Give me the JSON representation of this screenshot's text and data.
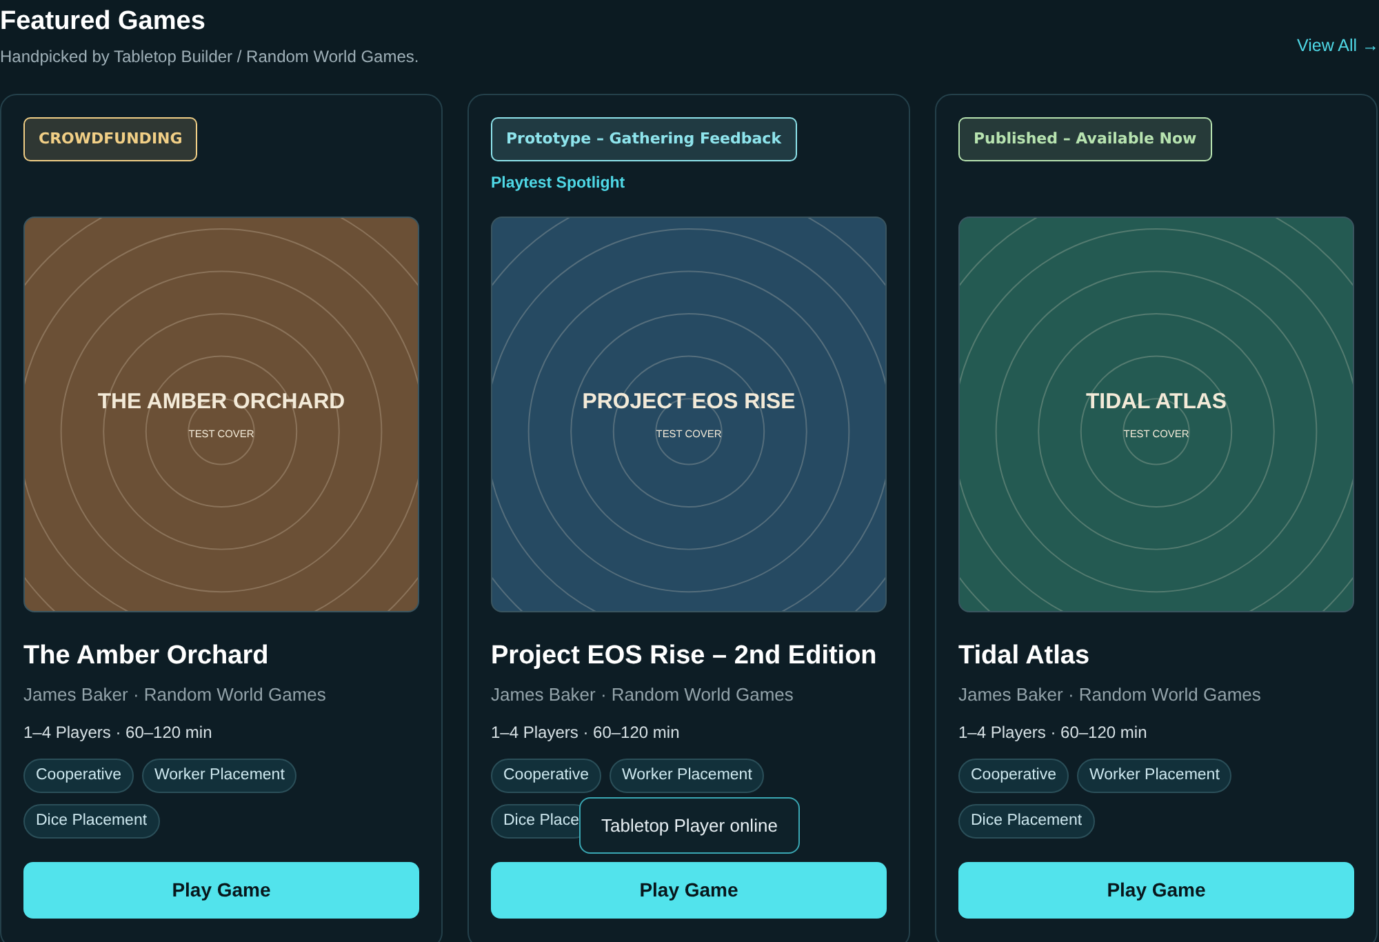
{
  "header": {
    "title": "Featured Games",
    "subtitle": "Handpicked by Tabletop Builder / Random World Games.",
    "link": "View All →"
  },
  "games": [
    {
      "status": {
        "text": "CROWDFUNDING",
        "color": "#f1cf86"
      },
      "cover": {
        "title": "THE AMBER ORCHARD",
        "caption": "TEST COVER",
        "color": "#6b5036"
      },
      "title": "The Amber Orchard",
      "byline": "James Baker · Random World Games",
      "meta": "1–4 Players · 60–120 min",
      "tags": [
        "Cooperative",
        "Worker Placement",
        "Dice Placement"
      ],
      "button": "Play Game"
    },
    {
      "status": {
        "text": "Prototype – Gathering Feedback",
        "color": "#8ee4ec"
      },
      "spotlight": "Playtest Spotlight",
      "cover": {
        "title": "PROJECT EOS RISE",
        "caption": "TEST COVER",
        "color": "#264a62"
      },
      "title": "Project EOS Rise – 2nd Edition",
      "byline": "James Baker · Random World Games",
      "meta": "1–4 Players · 60–120 min",
      "tags": [
        "Cooperative",
        "Worker Placement",
        "Dice Place"
      ],
      "tooltip": "Tabletop Player online",
      "button": "Play Game"
    },
    {
      "status": {
        "text": "Published – Available Now",
        "color": "#b7e3b0"
      },
      "cover": {
        "title": "TIDAL ATLAS",
        "caption": "TEST COVER",
        "color": "#245a52"
      },
      "title": "Tidal Atlas",
      "byline": "James Baker · Random World Games",
      "meta": "1–4 Players · 60–120 min",
      "tags": [
        "Cooperative",
        "Worker Placement",
        "Dice Placement"
      ],
      "button": "Play Game"
    }
  ]
}
